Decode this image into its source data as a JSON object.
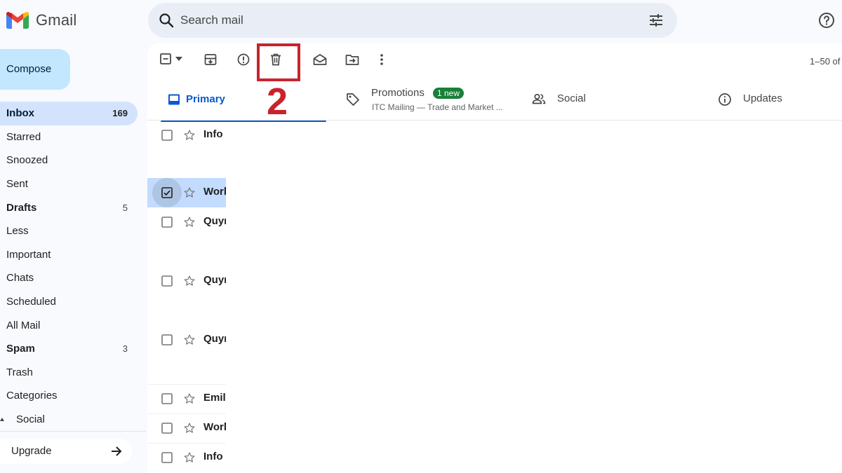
{
  "app": {
    "name": "Gmail"
  },
  "search": {
    "placeholder": "Search mail"
  },
  "compose": {
    "label": "Compose"
  },
  "nav": [
    {
      "label": "Inbox",
      "count": "169"
    },
    {
      "label": "Starred",
      "count": ""
    },
    {
      "label": "Snoozed",
      "count": ""
    },
    {
      "label": "Sent",
      "count": ""
    },
    {
      "label": "Drafts",
      "count": "5"
    },
    {
      "label": "Less",
      "count": ""
    },
    {
      "label": "Important",
      "count": ""
    },
    {
      "label": "Chats",
      "count": ""
    },
    {
      "label": "Scheduled",
      "count": ""
    },
    {
      "label": "All Mail",
      "count": ""
    },
    {
      "label": "Spam",
      "count": "3"
    },
    {
      "label": "Trash",
      "count": ""
    },
    {
      "label": "Categories",
      "count": ""
    },
    {
      "label": "Social",
      "count": ""
    }
  ],
  "upgrade": {
    "label": "Upgrade"
  },
  "toolbar": {
    "pager": "1–50 of"
  },
  "annotation": {
    "step": "2"
  },
  "tabs": {
    "primary": {
      "label": "Primary"
    },
    "promotions": {
      "label": "Promotions",
      "badge": "1 new",
      "subtitle": "ITC Mailing — Trade and Market ..."
    },
    "social": {
      "label": "Social"
    },
    "updates": {
      "label": "Updates"
    }
  },
  "emails": [
    {
      "sender": "Info",
      "selected": false
    },
    {
      "sender": "World",
      "selected": true
    },
    {
      "sender": "Quynh",
      "selected": false
    },
    {
      "sender": "Quynh",
      "selected": false
    },
    {
      "sender": "Quynh",
      "selected": false
    },
    {
      "sender": "Emily",
      "selected": false
    },
    {
      "sender": "World",
      "selected": false
    },
    {
      "sender": "Info",
      "selected": false
    }
  ],
  "colors": {
    "accent": "#0b57d0",
    "compose_bg": "#c2e7ff",
    "active_nav_bg": "#d3e3fd",
    "annotation": "#c8232c",
    "badge": "#188038"
  }
}
